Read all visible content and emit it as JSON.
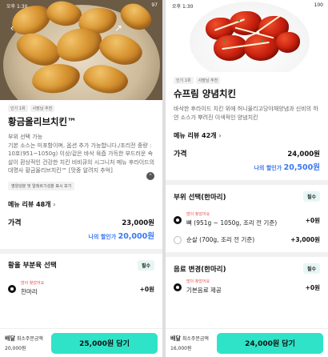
{
  "left": {
    "status": {
      "time": "오후 1:30",
      "battery": "97"
    },
    "badges": [
      "인기 1위",
      "사장님 추천"
    ],
    "title": "황금올리브치킨™",
    "description": "부위 선택 가능\n기본 소스는 미포함이며, 옵션 추가 가능합니다./조리전 중량 : 10호(951~1050g) 이상/겉은 바삭 육즙 가득한 부드러운 속살이 환상적인 건강한 치킨 비비큐의 시그니처 메뉴 후라이드의 대명사 황금올리브치킨™ [맛중 알려지 추억]",
    "info_chip": "영양성분 및 알레르기성분 표시 보기",
    "review": "메뉴 리뷰 48개",
    "review_chevron": "›",
    "price_label": "가격",
    "price": "23,000원",
    "discount_label": "나의 할인가",
    "discount_price": "20,000원",
    "section_title": "황올 부분육 선택",
    "required": "필수",
    "options": [
      {
        "popular": "많이 찾았어요",
        "name": "한마리",
        "price": "+0원",
        "selected": true
      }
    ],
    "bottom": {
      "delivery": "배달",
      "min_label": "최소주문금액",
      "min_amount": "20,000원",
      "cta": "25,000원 담기"
    }
  },
  "right": {
    "status": {
      "time": "오후 1:30",
      "battery": "100"
    },
    "badges": [
      "인기 1위",
      "사장님 추천"
    ],
    "title": "슈프림 양념치킨",
    "description": "바삭한 후라이드 치킨 위에 허니올리고당야채양념과 신비의 하얀 소스가 뿌려진 이색적인 양념치킨",
    "review": "메뉴 리뷰 42개",
    "review_chevron": "›",
    "price_label": "가격",
    "price": "24,000원",
    "discount_label": "나의 할인가",
    "discount_price": "20,500원",
    "section_title": "부위 선택(한마리)",
    "required": "필수",
    "options": [
      {
        "popular": "많이 찾았어요",
        "name": "뼈 (951g ~ 1050g, 조리 전 기준)",
        "price": "+0원",
        "selected": true
      },
      {
        "popular": "",
        "name": "순살 (700g, 조리 전 기준)",
        "price": "+3,000원",
        "selected": false
      }
    ],
    "section2_title": "음료 변경(한마리)",
    "required2": "필수",
    "options2": [
      {
        "popular": "많이 찾았어요",
        "name": "기본음료 제공",
        "price": "+0원",
        "selected": true
      }
    ],
    "bottom": {
      "delivery": "배달",
      "min_label": "최소주문금액",
      "min_amount": "16,000원",
      "cta": "24,000원 담기"
    }
  },
  "colors": {
    "accent": "#2ee3c8",
    "discount": "#3a78f2",
    "popular": "#e84d4d"
  }
}
